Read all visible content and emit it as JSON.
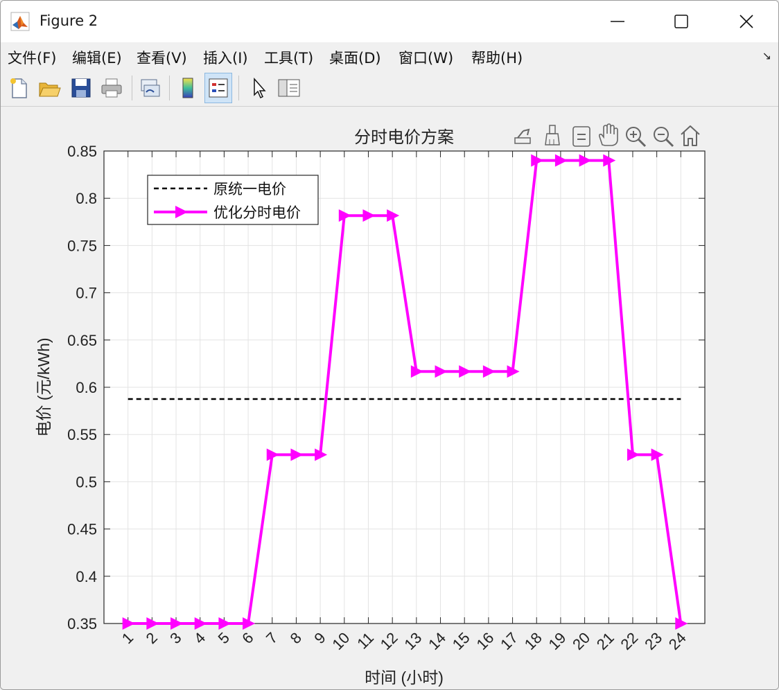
{
  "window": {
    "title": "Figure 2",
    "controls": {
      "minimize": "minimize",
      "maximize": "maximize",
      "close": "close"
    }
  },
  "menu": {
    "items": [
      "文件(F)",
      "编辑(E)",
      "查看(V)",
      "插入(I)",
      "工具(T)",
      "桌面(D)",
      "窗口(W)",
      "帮助(H)"
    ],
    "corner_glyph": "↘"
  },
  "toolbar": {
    "buttons": [
      "new-file-icon",
      "open-folder-icon",
      "save-icon",
      "print-icon",
      "link-figure-icon",
      "colorbar-icon",
      "legend-icon",
      "edit-pointer-icon",
      "property-inspector-icon"
    ],
    "active": "legend-icon"
  },
  "axes_toolbar": {
    "buttons": [
      "export-icon",
      "brush-icon",
      "data-tips-icon",
      "pan-icon",
      "zoom-in-icon",
      "zoom-out-icon",
      "home-icon"
    ]
  },
  "chart_data": {
    "type": "line",
    "title": "分时电价方案",
    "xlabel": "时间 (小时)",
    "ylabel": "电价 (元/kWh)",
    "x": [
      1,
      2,
      3,
      4,
      5,
      6,
      7,
      8,
      9,
      10,
      11,
      12,
      13,
      14,
      15,
      16,
      17,
      18,
      19,
      20,
      21,
      22,
      23,
      24
    ],
    "xlim": [
      0,
      25
    ],
    "ylim": [
      0.35,
      0.85
    ],
    "yticks": [
      0.35,
      0.4,
      0.45,
      0.5,
      0.55,
      0.6,
      0.65,
      0.7,
      0.75,
      0.8,
      0.85
    ],
    "ytick_labels": [
      "0.35",
      "0.4",
      "0.45",
      "0.5",
      "0.55",
      "0.6",
      "0.65",
      "0.7",
      "0.75",
      "0.8",
      "0.85"
    ],
    "grid": true,
    "legend_position": "top-left",
    "series": [
      {
        "name": "原统一电价",
        "style": "dashed",
        "color": "#000000",
        "x": [
          1,
          24
        ],
        "values": [
          0.5875,
          0.5875
        ]
      },
      {
        "name": "优化分时电价",
        "style": "solid-triangle-right",
        "color": "#ff00ff",
        "values": [
          0.35,
          0.35,
          0.35,
          0.35,
          0.35,
          0.35,
          0.5286,
          0.5286,
          0.5286,
          0.7817,
          0.7817,
          0.7817,
          0.6167,
          0.6167,
          0.6167,
          0.6167,
          0.6167,
          0.84,
          0.84,
          0.84,
          0.84,
          0.5286,
          0.5286,
          0.35
        ]
      }
    ]
  }
}
